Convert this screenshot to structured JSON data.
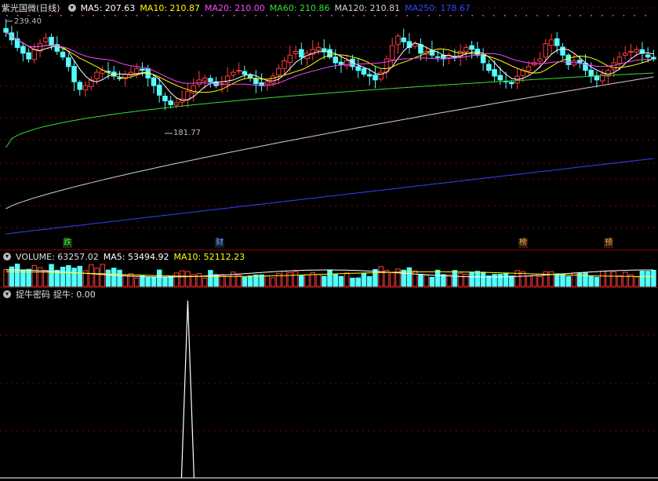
{
  "main_header": {
    "title": "紫光国微(日线)",
    "ma5": "MA5: 207.63",
    "ma10": "MA10: 210.87",
    "ma20": "MA20: 210.00",
    "ma60": "MA60: 210.86",
    "ma120": "MA120: 210.81",
    "ma250": "MA250: 178.67"
  },
  "price_labels": {
    "high": "239.40",
    "low": "181.77"
  },
  "event_tags": [
    "跌",
    "财",
    "榜",
    "预"
  ],
  "volume_header": {
    "volume": "VOLUME: 63257.02",
    "ma5": "MA5: 53494.92",
    "ma10": "MA10: 52112.23"
  },
  "indicator_header": {
    "name": "捉牛密码",
    "value": "捉牛: 0.00"
  },
  "colors": {
    "up": "#ff3b3b",
    "down": "#54ffff",
    "ma5": "#ffffff",
    "ma10": "#ffff00",
    "ma20": "#ff44ff",
    "ma60": "#33dd33",
    "ma120": "#d0d0d0",
    "ma250": "#3344ff",
    "grid": "#8b0000"
  },
  "chart_data": {
    "type": "candlestick",
    "price_range": [
      181.77,
      239.4
    ],
    "closes": [
      234,
      230,
      226,
      223,
      220,
      225,
      228,
      231,
      227,
      224,
      221,
      216,
      208,
      204,
      206,
      209,
      213,
      214,
      213,
      211,
      210,
      212,
      213,
      215,
      214,
      210,
      206,
      201,
      198,
      196,
      197,
      199,
      203,
      206,
      209,
      210,
      208,
      206,
      207,
      211,
      213,
      214,
      212,
      210,
      207,
      206,
      208,
      211,
      215,
      219,
      222,
      224,
      221,
      223,
      225,
      226,
      224,
      221,
      218,
      217,
      219,
      216,
      214,
      212,
      211,
      209,
      213,
      220,
      227,
      232,
      229,
      226,
      228,
      223,
      224,
      222,
      221,
      220,
      222,
      221,
      224,
      226,
      225,
      222,
      218,
      214,
      211,
      209,
      208,
      207,
      211,
      214,
      216,
      218,
      220,
      228,
      230,
      227,
      222,
      217,
      219,
      218,
      214,
      211,
      209,
      212,
      214,
      218,
      221,
      223,
      224,
      225,
      223,
      221,
      220
    ],
    "volume_range": [
      0,
      80000
    ],
    "indicator_spike_index": 32
  }
}
